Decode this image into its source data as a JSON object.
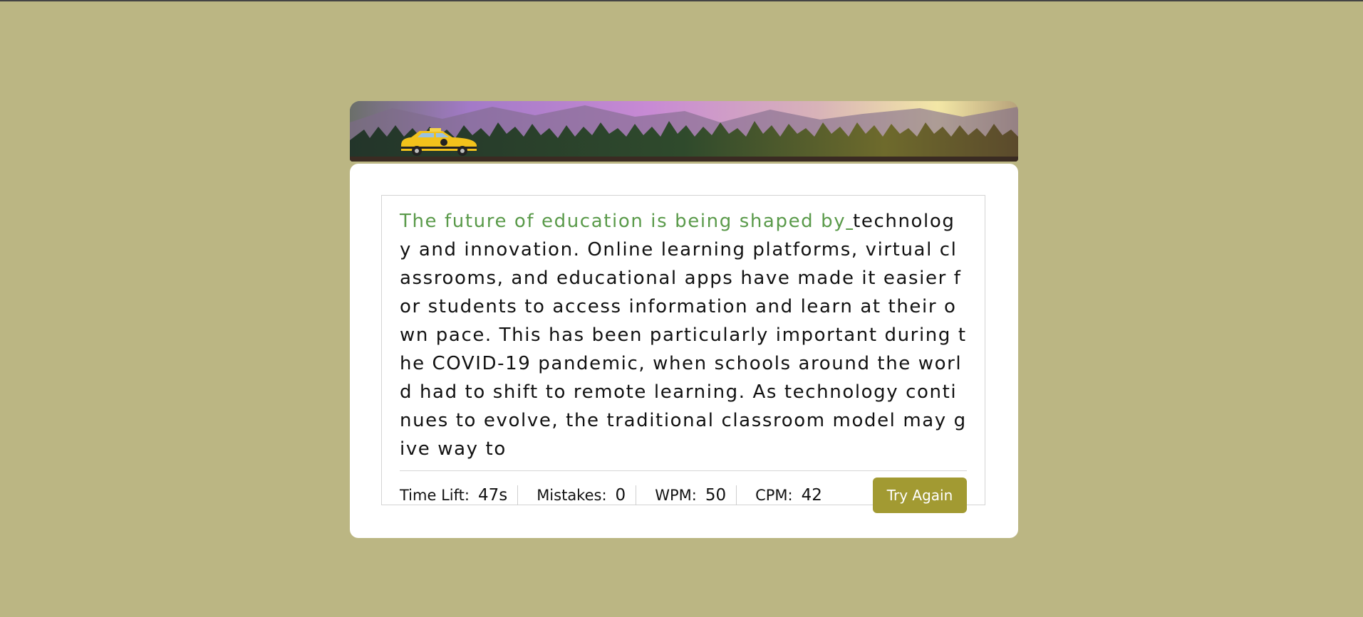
{
  "passage": {
    "typed_text": "The future of education is being shaped by",
    "cursor_char": " ",
    "remaining_text": "technology and innovation. Online learning platforms, virtual classrooms, and educational apps have made it easier for students to access information and learn at their own pace. This has been particularly important during the COVID-19 pandemic, when schools around the world had to shift to remote learning. As technology continues to evolve, the traditional classroom model may give way to"
  },
  "stats": {
    "time_label": "Time Lift:",
    "time_value": "47s",
    "mistakes_label": "Mistakes:",
    "mistakes_value": "0",
    "wpm_label": "WPM:",
    "wpm_value": "50",
    "cpm_label": "CPM:",
    "cpm_value": "42"
  },
  "actions": {
    "try_again_label": "Try Again"
  },
  "colors": {
    "background": "#bbb683",
    "typed_text": "#5a9a4a",
    "button": "#a29a32"
  },
  "icons": {
    "banner_vehicle": "taxi-icon"
  }
}
